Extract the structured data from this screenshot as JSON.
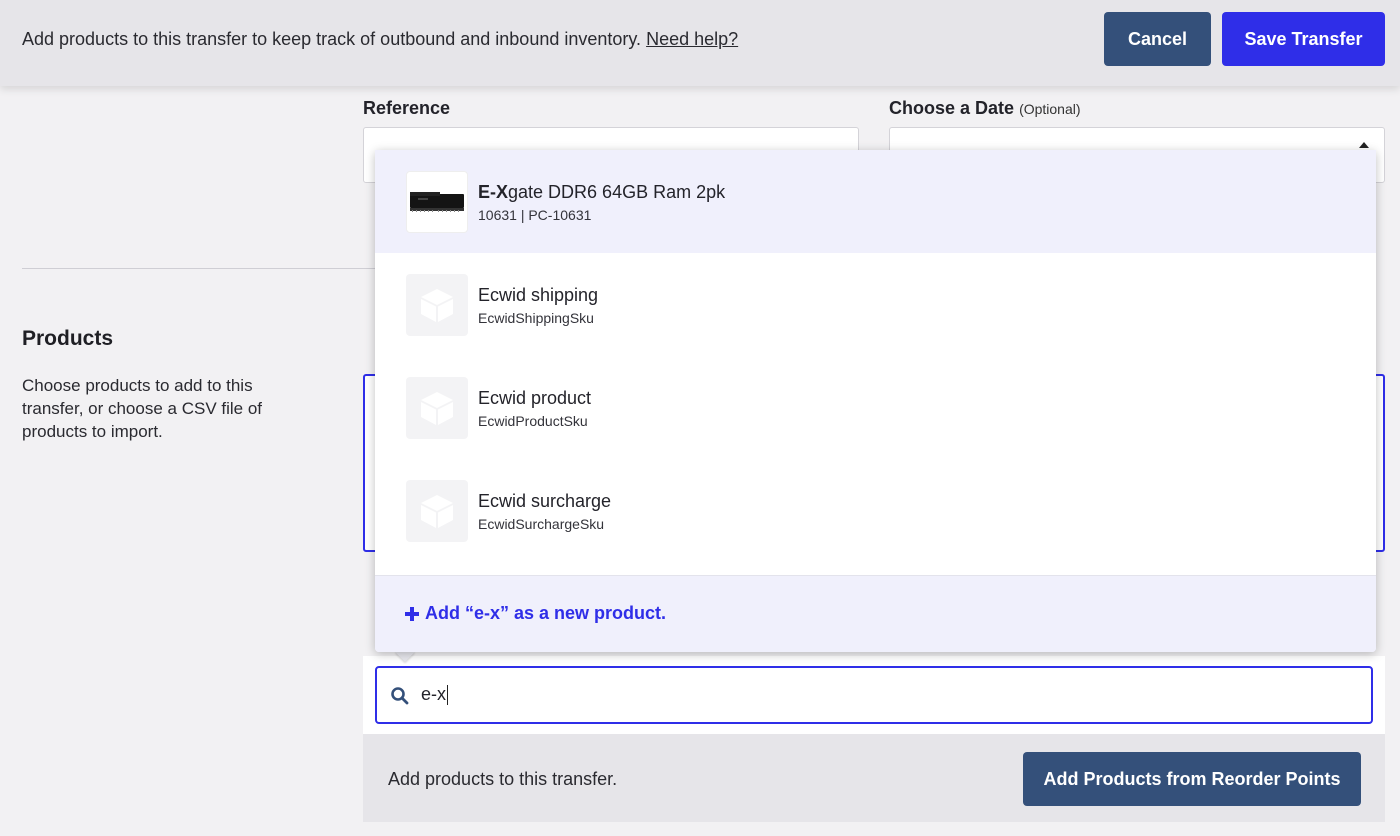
{
  "topbar": {
    "message": "Add products to this transfer to keep track of outbound and inbound inventory.",
    "help_link": "Need help?",
    "cancel_label": "Cancel",
    "save_label": "Save Transfer"
  },
  "form": {
    "reference_label": "Reference",
    "date_label": "Choose a Date",
    "date_optional": "(Optional)"
  },
  "products_section": {
    "title": "Products",
    "description": "Choose products to add to this transfer, or choose a CSV file of products to import."
  },
  "dropdown": {
    "items": [
      {
        "name_match": "E-X",
        "name_rest": "gate DDR6 64GB Ram 2pk",
        "sku": "10631 | PC-10631",
        "thumb": "ram-stick-image",
        "selected": true
      },
      {
        "name_match": "",
        "name_rest": "Ecwid shipping",
        "sku": "EcwidShippingSku",
        "thumb": "box-icon",
        "selected": false
      },
      {
        "name_match": "",
        "name_rest": "Ecwid product",
        "sku": "EcwidProductSku",
        "thumb": "box-icon",
        "selected": false
      },
      {
        "name_match": "",
        "name_rest": "Ecwid surcharge",
        "sku": "EcwidSurchargeSku",
        "thumb": "box-icon",
        "selected": false
      }
    ],
    "add_new_label": "Add “e-x” as a new product."
  },
  "search": {
    "value": "e-x"
  },
  "footer": {
    "hint": "Add products to this transfer.",
    "reorder_button": "Add Products from Reorder Points"
  },
  "colors": {
    "primary": "#2f2ee8",
    "navy": "#34507a",
    "selected_row": "#f0f0fc"
  }
}
